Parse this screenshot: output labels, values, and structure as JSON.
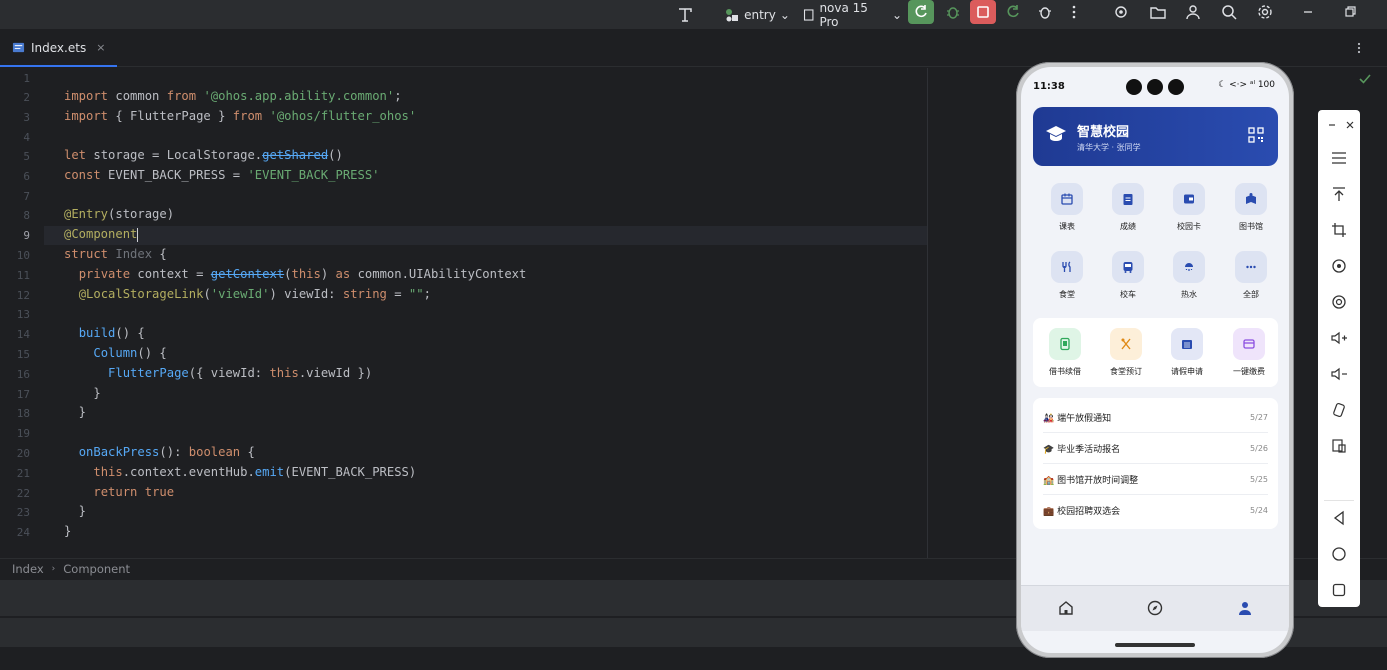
{
  "toolbar": {
    "module": "entry",
    "device": "nova 15 Pro"
  },
  "tab": {
    "filename": "Index.ets",
    "close": "×"
  },
  "breadcrumb": {
    "item1": "Index",
    "item2": "Component"
  },
  "editor": {
    "line_numbers": [
      "1",
      "2",
      "3",
      "4",
      "5",
      "6",
      "7",
      "8",
      "9",
      "10",
      "11",
      "12",
      "13",
      "14",
      "15",
      "16",
      "17",
      "18",
      "19",
      "20",
      "21",
      "22",
      "23",
      "24"
    ]
  },
  "phone": {
    "time": "11:38",
    "status_right": "☾ <·> ᵃˡ 100",
    "app_title": "智慧校园",
    "app_subtitle": "清华大学 · 张同学",
    "grid": [
      {
        "label": "课表",
        "icon": "calendar-icon"
      },
      {
        "label": "成绩",
        "icon": "clipboard-icon"
      },
      {
        "label": "校园卡",
        "icon": "wallet-icon"
      },
      {
        "label": "图书馆",
        "icon": "book-icon"
      },
      {
        "label": "食堂",
        "icon": "utensils-icon"
      },
      {
        "label": "校车",
        "icon": "bus-icon"
      },
      {
        "label": "热水",
        "icon": "shower-icon"
      },
      {
        "label": "全部",
        "icon": "more-icon"
      }
    ],
    "quick": [
      {
        "label": "借书续借",
        "icon": "phone-book-icon",
        "bg": "#dff5e6",
        "fg": "#2fa85a"
      },
      {
        "label": "食堂预订",
        "icon": "fork-spoon-icon",
        "bg": "#fdefd9",
        "fg": "#e08a16"
      },
      {
        "label": "请假申请",
        "icon": "calendar-grid-icon",
        "bg": "#e3e7f6",
        "fg": "#2a4cb0"
      },
      {
        "label": "一键缴费",
        "icon": "card-icon",
        "bg": "#efe4fb",
        "fg": "#8b4fe0"
      }
    ],
    "notices": [
      {
        "emoji": "🎎",
        "title": "端午放假通知",
        "date": "5/27"
      },
      {
        "emoji": "🎓",
        "title": "毕业季活动报名",
        "date": "5/26"
      },
      {
        "emoji": "🏫",
        "title": "图书馆开放时间调整",
        "date": "5/25"
      },
      {
        "emoji": "💼",
        "title": "校园招聘双选会",
        "date": "5/24"
      }
    ]
  },
  "colors": {
    "accent": "#3574f0",
    "header_blue": "#1f3a93",
    "run_green": "#57965c",
    "stop_red": "#db5c5c"
  }
}
